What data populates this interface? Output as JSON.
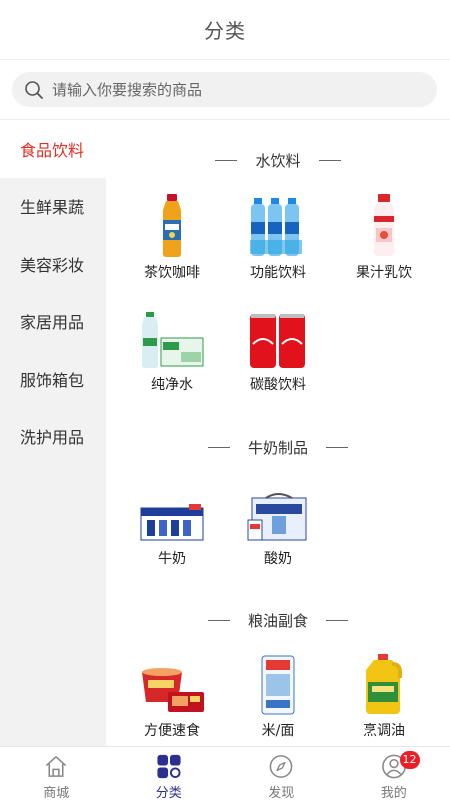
{
  "header": {
    "title": "分类"
  },
  "search": {
    "placeholder": "请输入你要搜索的商品"
  },
  "sidebar": {
    "items": [
      {
        "label": "食品饮料",
        "active": true
      },
      {
        "label": "生鲜果蔬"
      },
      {
        "label": "美容彩妆"
      },
      {
        "label": "家居用品"
      },
      {
        "label": "服饰箱包"
      },
      {
        "label": "洗护用品"
      }
    ]
  },
  "sections": [
    {
      "title": "水饮料",
      "products": [
        {
          "label": "茶饮咖啡",
          "icon": "tea-bottle-icon"
        },
        {
          "label": "功能饮料",
          "icon": "water-pack-icon"
        },
        {
          "label": "果汁乳饮",
          "icon": "juice-bottle-icon"
        },
        {
          "label": "纯净水",
          "icon": "pure-water-icon"
        },
        {
          "label": "碳酸饮料",
          "icon": "soda-can-icon"
        }
      ]
    },
    {
      "title": "牛奶制品",
      "products": [
        {
          "label": "牛奶",
          "icon": "milk-box-icon"
        },
        {
          "label": "酸奶",
          "icon": "yogurt-box-icon"
        }
      ]
    },
    {
      "title": "粮油副食",
      "products": [
        {
          "label": "方便速食",
          "icon": "instant-noodle-icon"
        },
        {
          "label": "米/面",
          "icon": "rice-bag-icon"
        },
        {
          "label": "烹调油",
          "icon": "oil-bottle-icon"
        }
      ]
    }
  ],
  "tabbar": {
    "items": [
      {
        "label": "商城",
        "icon": "home-icon"
      },
      {
        "label": "分类",
        "icon": "category-icon",
        "active": true
      },
      {
        "label": "发现",
        "icon": "compass-icon"
      },
      {
        "label": "我的",
        "icon": "user-icon",
        "badge": "12"
      }
    ]
  },
  "colors": {
    "accent": "#e02e24",
    "tab_active": "#2b2f8f",
    "badge": "#ee1c25"
  }
}
